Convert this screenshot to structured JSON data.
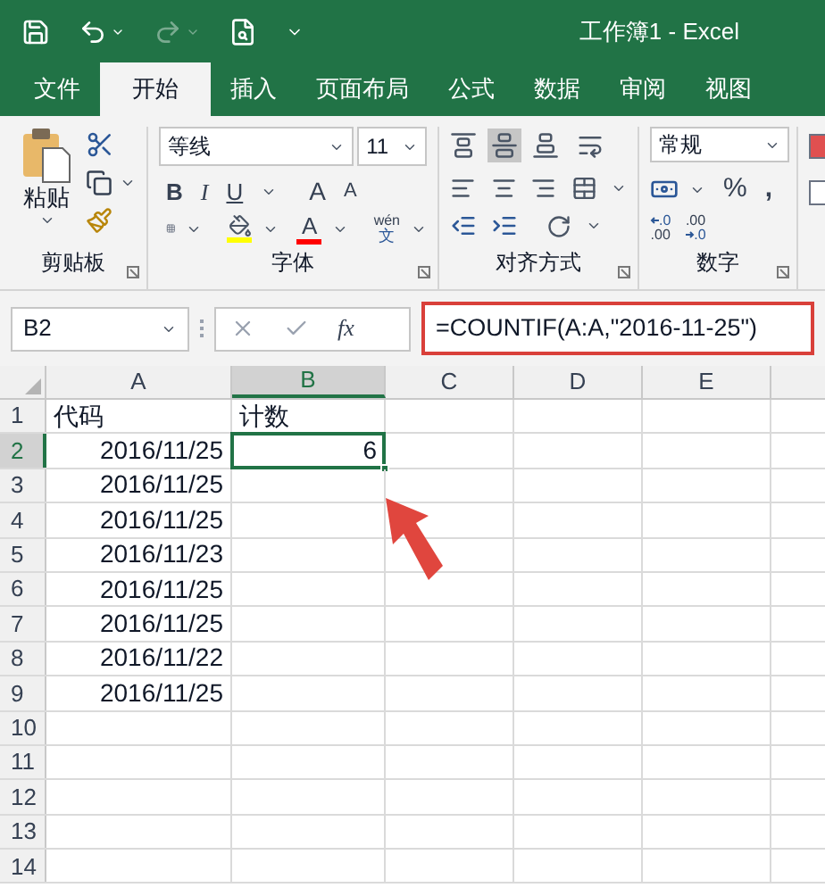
{
  "window": {
    "title": "工作簿1  -  Excel"
  },
  "tabs": [
    {
      "label": "文件",
      "selected": false
    },
    {
      "label": "开始",
      "selected": true
    },
    {
      "label": "插入",
      "selected": false
    },
    {
      "label": "页面布局",
      "selected": false
    },
    {
      "label": "公式",
      "selected": false
    },
    {
      "label": "数据",
      "selected": false
    },
    {
      "label": "审阅",
      "selected": false
    },
    {
      "label": "视图",
      "selected": false
    }
  ],
  "ribbon": {
    "clipboard": {
      "paste_label": "粘贴",
      "group_label": "剪贴板"
    },
    "font": {
      "font_name": "等线",
      "font_size": "11",
      "style_buttons": [
        "B",
        "I",
        "U"
      ],
      "grow_font": "A",
      "shrink_font": "A",
      "font_color": "A",
      "phonetic_top": "wén",
      "phonetic_bottom": "文",
      "group_label": "字体"
    },
    "alignment": {
      "group_label": "对齐方式"
    },
    "number": {
      "format": "常规",
      "percent": "%",
      "comma": ",",
      "increase_decimal": [
        ".0",
        ".00"
      ],
      "decrease_decimal": [
        ".00",
        ".0"
      ],
      "group_label": "数字"
    }
  },
  "formula_bar": {
    "name_box": "B2",
    "fx": "fx",
    "formula": "=COUNTIF(A:A,\"2016-11-25\")",
    "highlighted": true
  },
  "sheet": {
    "columns": [
      {
        "label": "A",
        "selected": false
      },
      {
        "label": "B",
        "selected": true
      },
      {
        "label": "C",
        "selected": false
      },
      {
        "label": "D",
        "selected": false
      },
      {
        "label": "E",
        "selected": false
      }
    ],
    "rows": [
      {
        "label": "1",
        "selected": false,
        "cells": [
          "代码",
          "计数"
        ]
      },
      {
        "label": "2",
        "selected": true,
        "cells": [
          "2016/11/25",
          "6"
        ]
      },
      {
        "label": "3",
        "selected": false,
        "cells": [
          "2016/11/25",
          ""
        ]
      },
      {
        "label": "4",
        "selected": false,
        "cells": [
          "2016/11/25",
          ""
        ]
      },
      {
        "label": "5",
        "selected": false,
        "cells": [
          "2016/11/23",
          ""
        ]
      },
      {
        "label": "6",
        "selected": false,
        "cells": [
          "2016/11/25",
          ""
        ]
      },
      {
        "label": "7",
        "selected": false,
        "cells": [
          "2016/11/25",
          ""
        ]
      },
      {
        "label": "8",
        "selected": false,
        "cells": [
          "2016/11/22",
          ""
        ]
      },
      {
        "label": "9",
        "selected": false,
        "cells": [
          "2016/11/25",
          ""
        ]
      },
      {
        "label": "10",
        "selected": false,
        "cells": [
          "",
          ""
        ]
      },
      {
        "label": "11",
        "selected": false,
        "cells": [
          "",
          ""
        ]
      },
      {
        "label": "12",
        "selected": false,
        "cells": [
          "",
          ""
        ]
      },
      {
        "label": "13",
        "selected": false,
        "cells": [
          "",
          ""
        ]
      },
      {
        "label": "14",
        "selected": false,
        "cells": [
          "",
          ""
        ]
      }
    ]
  }
}
